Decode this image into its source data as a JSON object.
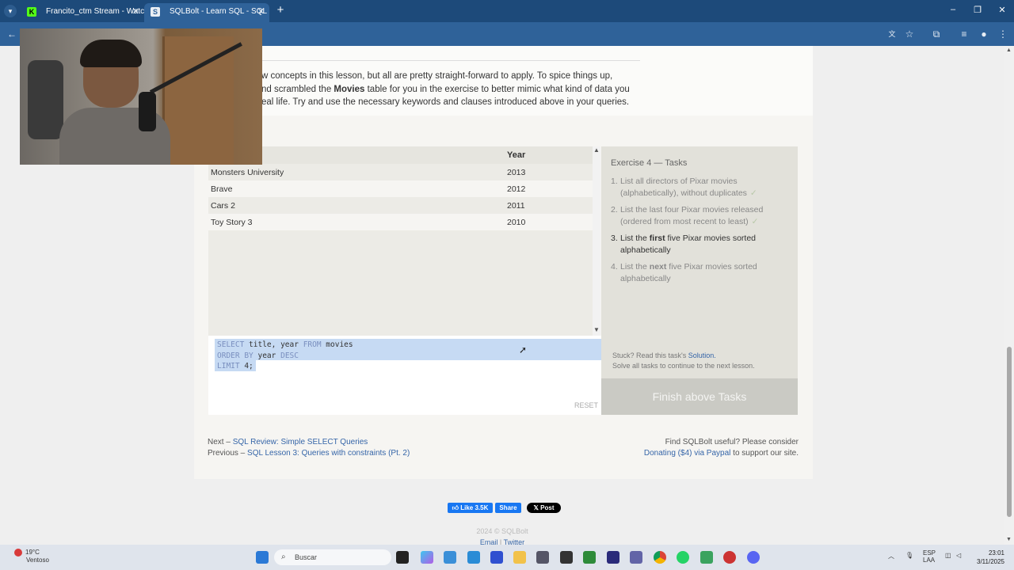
{
  "browser": {
    "tabs": [
      {
        "label": "Francito_ctm Stream - Watch Li",
        "active": false
      },
      {
        "label": "SQLBolt - Learn SQL - SQL Less",
        "active": true
      }
    ],
    "new_tab": "+",
    "window_controls": {
      "minimize": "–",
      "maximize": "❐",
      "close": "✕"
    }
  },
  "intro": {
    "line1": "w concepts in this lesson, but all are pretty straight-forward to apply. To spice things up,",
    "line2_pre": "nd scrambled the ",
    "line2_bold": "Movies",
    "line2_post": " table for you in the exercise to better mimic what kind of data you",
    "line3": "eal life. Try and use the necessary keywords and clauses introduced above in your queries."
  },
  "results": {
    "column_year": "Year",
    "rows": [
      {
        "title": "Monsters University",
        "year": "2013"
      },
      {
        "title": "Brave",
        "year": "2012"
      },
      {
        "title": "Cars 2",
        "year": "2011"
      },
      {
        "title": "Toy Story 3",
        "year": "2010"
      }
    ]
  },
  "editor": {
    "line1_kw": "SELECT",
    "line1_rest": " title, year ",
    "line1_kw2": "FROM",
    "line1_end": " movies",
    "line2_kw": "ORDER BY",
    "line2_rest": " year ",
    "line2_kw2": "DESC",
    "line3_kw": "LIMIT",
    "line3_rest": " 4;",
    "reset_label": "RESET"
  },
  "tasks": {
    "heading": "Exercise 4 — Tasks",
    "items": [
      {
        "num": "1.",
        "text": "List all directors of Pixar movies (alphabetically), without duplicates",
        "check": "✓"
      },
      {
        "num": "2.",
        "text": "List the last four Pixar movies released (ordered from most recent to least)",
        "check": "✓"
      },
      {
        "num": "3.",
        "pre": "List the ",
        "bold": "first",
        "post": " five Pixar movies sorted alphabetically"
      },
      {
        "num": "4.",
        "pre": "List the ",
        "bold": "next",
        "post": " five Pixar movies sorted alphabetically"
      }
    ],
    "stuck_text": "Stuck? Read this task's ",
    "solution_link": "Solution.",
    "solve_all": "Solve all tasks to continue to the next lesson.",
    "finish_button": "Finish above Tasks"
  },
  "nav": {
    "next_prefix": "Next – ",
    "next_link": "SQL Review: Simple SELECT Queries",
    "prev_prefix": "Previous – ",
    "prev_link": "SQL Lesson 3: Queries with constraints (Pt. 2)",
    "support_line": "Find SQLBolt useful? Please consider",
    "donate_link": "Donating ($4) via Paypal",
    "donate_suffix": " to support our site."
  },
  "social": {
    "like": "Like 3.5K",
    "share": "Share",
    "post": "Post"
  },
  "footer": {
    "copyright": "2024 © SQLBolt",
    "email": "Email",
    "sep": " | ",
    "twitter": "Twitter"
  },
  "taskbar": {
    "temperature": "19°C",
    "weather": "Ventoso",
    "search_placeholder": "Buscar",
    "lang1": "ESP",
    "lang2": "LAA",
    "time": "23:01",
    "date": "3/11/2025"
  },
  "colors": {
    "tabbar": "#1d4a7a",
    "toolbar": "#2f6299",
    "link": "#3565a8",
    "selection": "#c6daf3"
  }
}
